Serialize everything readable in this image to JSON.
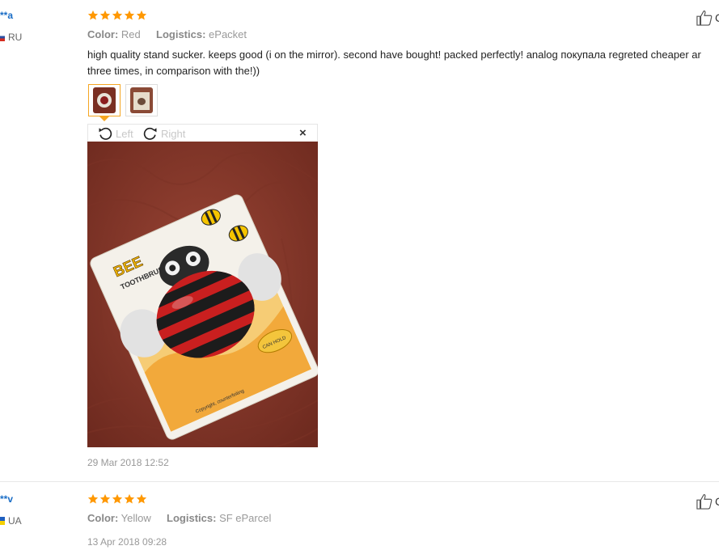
{
  "reviews": [
    {
      "user": "**a",
      "country": "RU",
      "rating": 5,
      "color_key": "Color:",
      "color_val": "Red",
      "logistics_key": "Logistics:",
      "logistics_val": "ePacket",
      "text_line1": "high quality stand sucker. keeps good (i on the mirror). second have bought! packed perfectly! analog покупала regreted cheaper ar",
      "text_line2": "three times, in comparison with the!))",
      "date": "29 Mar 2018 12:52",
      "viewer": {
        "rotate_left": "Left",
        "rotate_right": "Right",
        "close": "×"
      },
      "helpful_cut": "C"
    },
    {
      "user": "**v",
      "country": "UA",
      "rating": 5,
      "color_key": "Color:",
      "color_val": "Yellow",
      "logistics_key": "Logistics:",
      "logistics_val": "SF eParcel",
      "date": "13 Apr 2018 09:28",
      "helpful_cut": "C"
    }
  ],
  "colors": {
    "star": "#ff9800",
    "username": "#1a6dc6",
    "thumb_active": "#f5a623",
    "photo_background": "#8a3a2a"
  },
  "icons": [
    "star-icon",
    "thumbs-up-icon",
    "rotate-left-icon",
    "rotate-right-icon",
    "close-icon",
    "flag-icon"
  ]
}
